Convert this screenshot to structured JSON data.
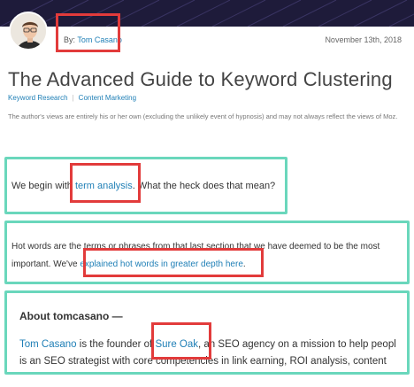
{
  "header": {
    "byline_prefix": "By:",
    "author": "Tom Casano",
    "date": "November 13th, 2018"
  },
  "article": {
    "title": "The Advanced Guide to Keyword Clustering",
    "categories": [
      "Keyword Research",
      "Content Marketing"
    ],
    "disclaimer": "The author's views are entirely his or her own (excluding the unlikely event of hypnosis) and may not always reflect the views of Moz."
  },
  "excerpts": {
    "p1_before": "We begin with ",
    "p1_link": "term analysis",
    "p1_after": ". What the heck does that mean?",
    "p2_text": "Hot words are the terms or phrases from that last section that we have deemed to be the most important. We've ",
    "p2_link": "explained hot words in greater depth here",
    "p2_after": "."
  },
  "about": {
    "heading": "About tomcasano —",
    "author_link": "Tom Casano",
    "line1_mid": " is the founder of ",
    "company_link": "Sure Oak",
    "line1_end": ", an SEO agency on a mission to help peopl",
    "line2": "is an SEO strategist with core competencies in link earning, ROI analysis, content"
  },
  "colors": {
    "link": "#1f7fb6",
    "highlight_red": "#e23b3b",
    "highlight_teal": "#6ad7bc",
    "banner": "#1e1b3a"
  }
}
